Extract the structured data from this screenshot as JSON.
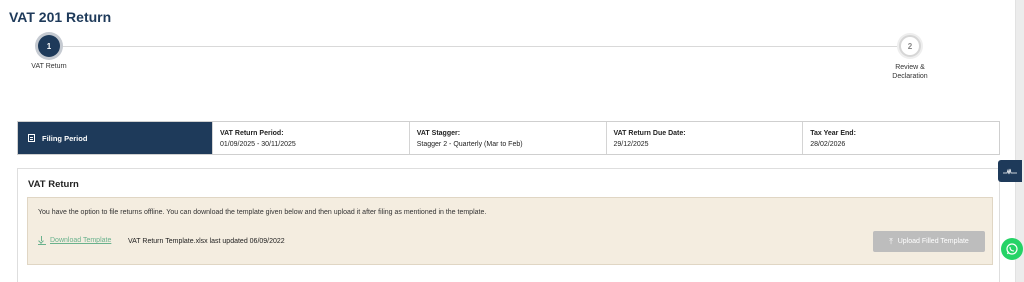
{
  "page": {
    "title": "VAT 201 Return"
  },
  "stepper": {
    "steps": [
      {
        "number": "1",
        "label": "VAT Return"
      },
      {
        "number": "2",
        "label": "Review &\nDeclaration"
      }
    ]
  },
  "filing_period": {
    "header": "Filing Period",
    "cells": [
      {
        "label": "VAT Return Period:",
        "value": "01/09/2025 - 30/11/2025"
      },
      {
        "label": "VAT Stagger:",
        "value": "Stagger 2 - Quarterly (Mar to Feb)"
      },
      {
        "label": "VAT Return Due Date:",
        "value": "29/12/2025"
      },
      {
        "label": "Tax Year End:",
        "value": "28/02/2026"
      }
    ]
  },
  "vat_return": {
    "title": "VAT Return",
    "offline_text": "You have the option to file returns offline. You can download the template given below and then upload it after filing as mentioned in the template.",
    "download_link": "Download Template",
    "template_info": "VAT Return Template.xlsx last updated 06/09/2022",
    "upload_button": "Upload Filled Template"
  },
  "colors": {
    "primary": "#1e3a5a",
    "link": "#6ab28d",
    "whatsapp": "#25d366",
    "panel_bg": "#f4ede0"
  },
  "icons": [
    "document-icon",
    "download-icon",
    "upload-icon",
    "signature-icon",
    "whatsapp-icon"
  ]
}
